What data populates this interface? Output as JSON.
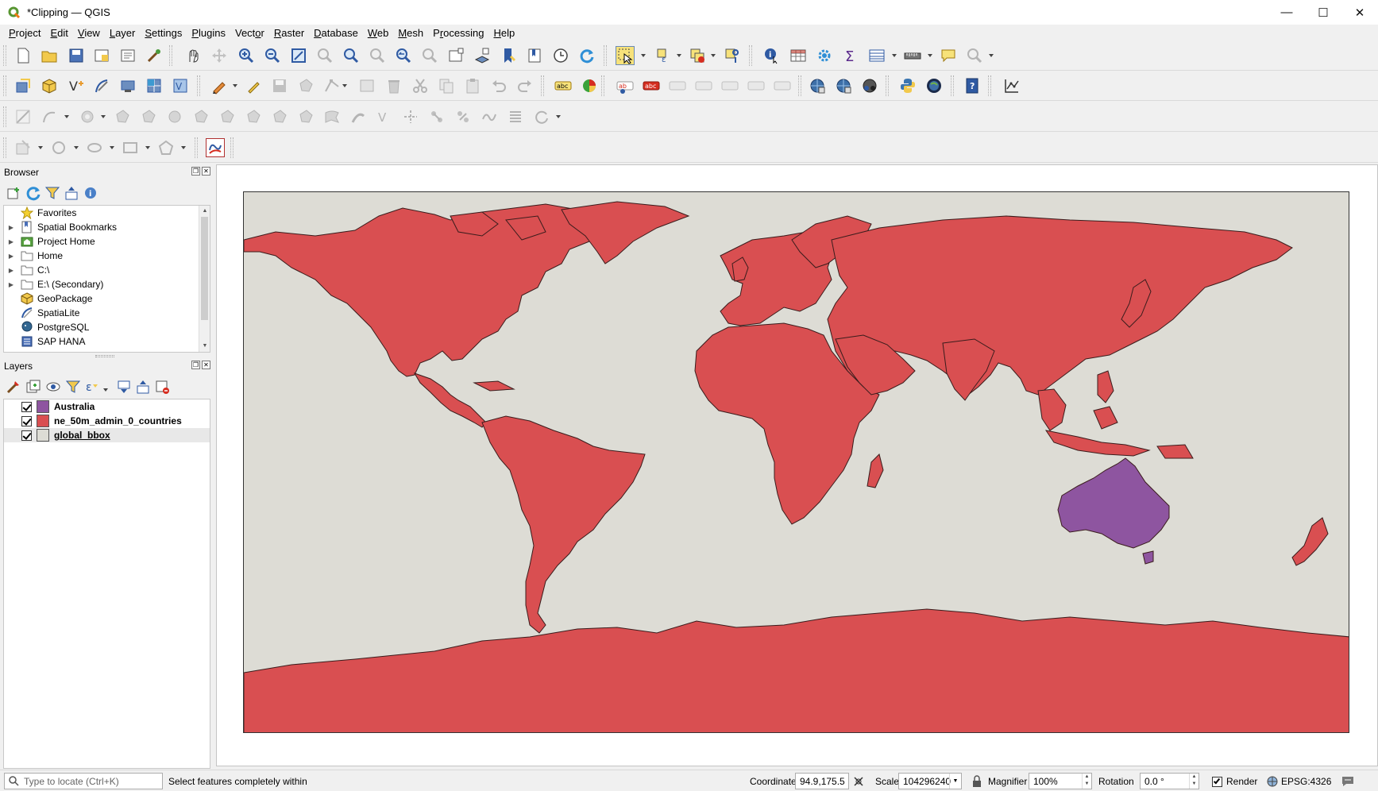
{
  "window": {
    "title": "*Clipping — QGIS",
    "controls": {
      "minimize": "—",
      "maximize": "☐",
      "close": "✕"
    }
  },
  "menubar": {
    "items": [
      {
        "label": "Project",
        "mnemonic": "P",
        "rest": "roject"
      },
      {
        "label": "Edit",
        "mnemonic": "E",
        "rest": "dit"
      },
      {
        "label": "View",
        "mnemonic": "V",
        "rest": "iew"
      },
      {
        "label": "Layer",
        "mnemonic": "L",
        "rest": "ayer"
      },
      {
        "label": "Settings",
        "mnemonic": "S",
        "rest": "ettings"
      },
      {
        "label": "Plugins",
        "mnemonic": "P",
        "rest": "lugins"
      },
      {
        "label": "Vector",
        "mnemonic": "o",
        "pre": "Vect",
        "rest": "r"
      },
      {
        "label": "Raster",
        "mnemonic": "R",
        "rest": "aster"
      },
      {
        "label": "Database",
        "mnemonic": "D",
        "rest": "atabase"
      },
      {
        "label": "Web",
        "mnemonic": "W",
        "rest": "eb"
      },
      {
        "label": "Mesh",
        "mnemonic": "M",
        "rest": "esh"
      },
      {
        "label": "Processing",
        "mnemonic": "r",
        "pre": "P",
        "rest": "ocessing"
      },
      {
        "label": "Help",
        "mnemonic": "H",
        "rest": "elp"
      }
    ]
  },
  "browser_panel": {
    "title": "Browser",
    "items": [
      {
        "label": "Favorites",
        "icon": "star-icon",
        "expandable": false
      },
      {
        "label": "Spatial Bookmarks",
        "icon": "bookmarks-icon",
        "expandable": true
      },
      {
        "label": "Project Home",
        "icon": "project-home-icon",
        "expandable": true
      },
      {
        "label": "Home",
        "icon": "folder-icon",
        "expandable": true
      },
      {
        "label": "C:\\",
        "icon": "folder-icon",
        "expandable": true
      },
      {
        "label": "E:\\ (Secondary)",
        "icon": "folder-icon",
        "expandable": true
      },
      {
        "label": "GeoPackage",
        "icon": "geopackage-icon",
        "expandable": false
      },
      {
        "label": "SpatiaLite",
        "icon": "spatialite-icon",
        "expandable": false
      },
      {
        "label": "PostgreSQL",
        "icon": "postgresql-icon",
        "expandable": false
      },
      {
        "label": "SAP HANA",
        "icon": "sap-hana-icon",
        "expandable": false
      }
    ]
  },
  "layers_panel": {
    "title": "Layers",
    "layers": [
      {
        "name": "Australia",
        "checked": true,
        "color": "#8e55a0"
      },
      {
        "name": "ne_50m_admin_0_countries",
        "checked": true,
        "color": "#d94f51"
      },
      {
        "name": "global_bbox",
        "checked": true,
        "color": "#dddcd5",
        "selected": true
      }
    ]
  },
  "map": {
    "background": "#dddcd5",
    "countries_color": "#d94f51",
    "highlight_color": "#8e55a0",
    "highlight_feature": "Australia"
  },
  "statusbar": {
    "locator_placeholder": "Type to locate (Ctrl+K)",
    "message": "Select features completely within",
    "coordinate_label": "Coordinate",
    "coordinate_value": "94.9,175.5",
    "scale_label": "Scale",
    "scale_value": "104296240",
    "magnifier_label": "Magnifier",
    "magnifier_value": "100%",
    "rotation_label": "Rotation",
    "rotation_value": "0.0 °",
    "render_label": "Render",
    "crs": "EPSG:4326"
  }
}
